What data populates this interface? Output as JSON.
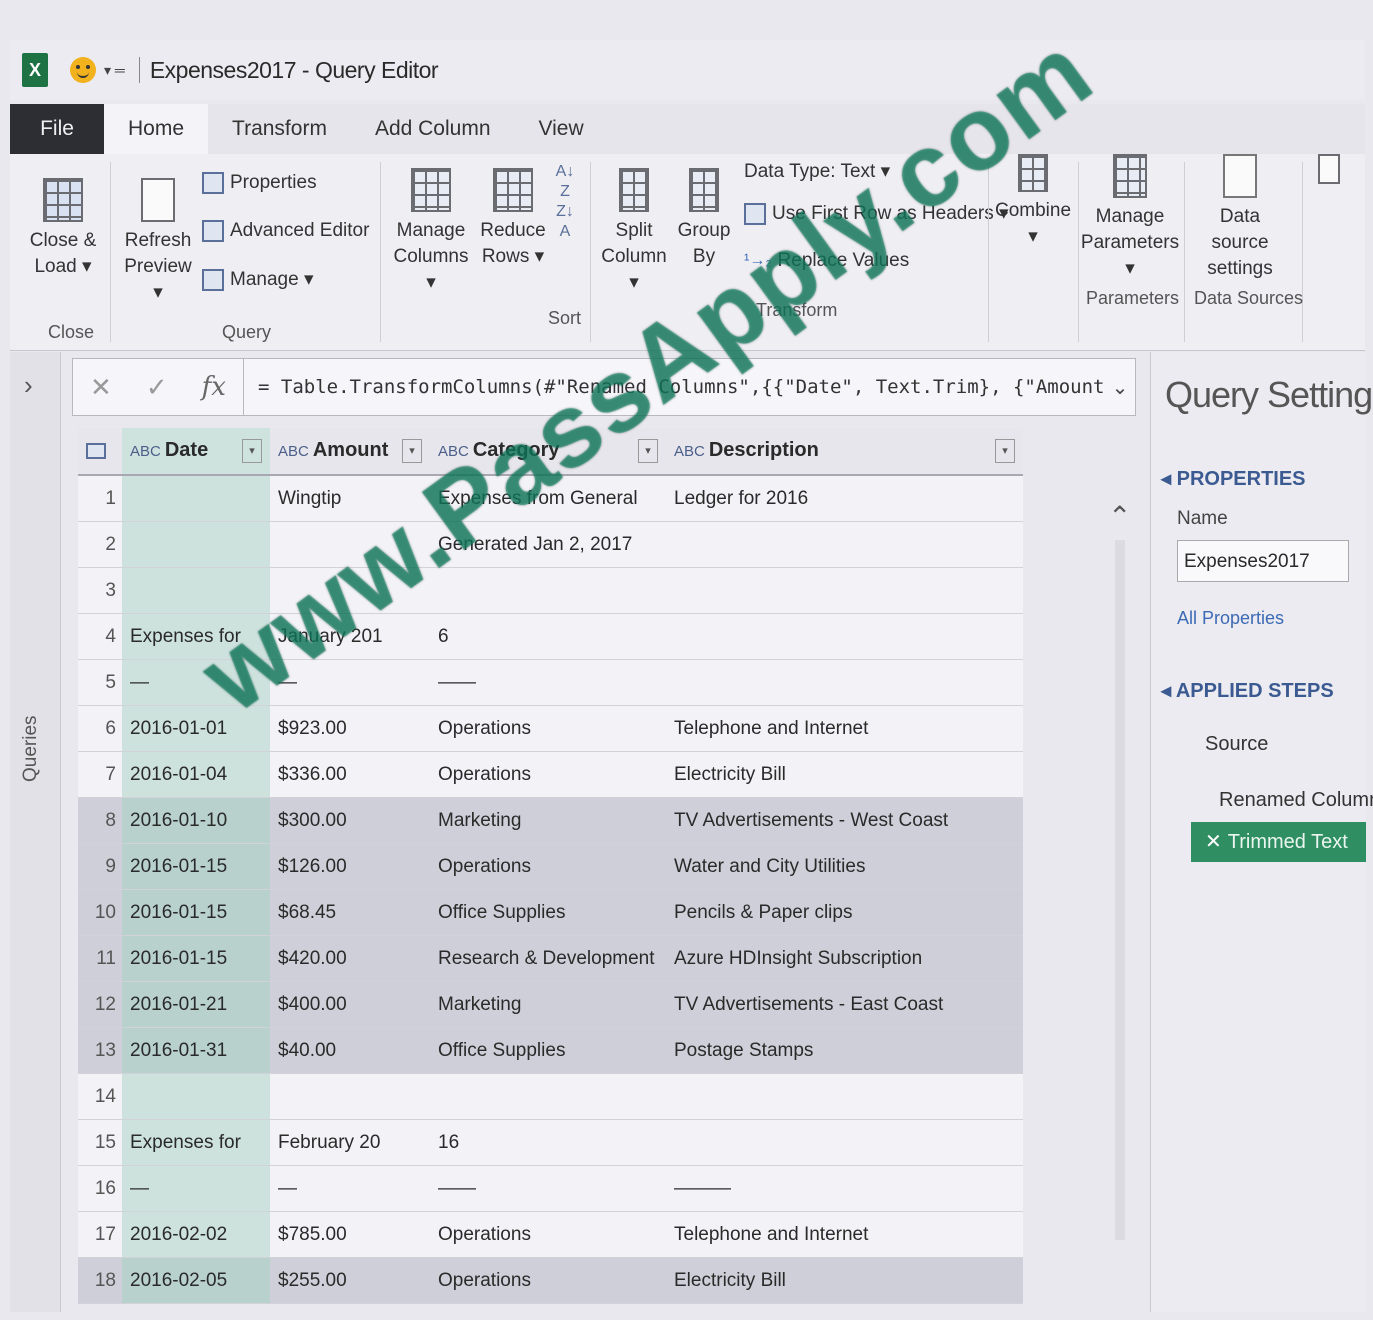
{
  "window": {
    "title": "Expenses2017 - Query Editor",
    "app_icon": "X"
  },
  "tabs": [
    {
      "label": "File"
    },
    {
      "label": "Home"
    },
    {
      "label": "Transform"
    },
    {
      "label": "Add Column"
    },
    {
      "label": "View"
    }
  ],
  "ribbon": {
    "close_load": [
      "Close &",
      "Load"
    ],
    "refresh_preview": [
      "Refresh",
      "Preview"
    ],
    "properties": "Properties",
    "advanced_editor": "Advanced Editor",
    "manage": "Manage",
    "manage_columns": [
      "Manage",
      "Columns"
    ],
    "reduce_rows": [
      "Reduce",
      "Rows"
    ],
    "split_column": [
      "Split",
      "Column"
    ],
    "group_by": [
      "Group",
      "By"
    ],
    "data_type": "Data Type: Text",
    "use_first_row": "Use First Row as Headers",
    "replace_values": "Replace Values",
    "combine": "Combine",
    "manage_parameters": [
      "Manage",
      "Parameters"
    ],
    "data_source_settings": [
      "Data source",
      "settings"
    ],
    "groups": {
      "close": "Close",
      "query": "Query",
      "sort": "Sort",
      "transform": "Transform",
      "parameters": "Parameters",
      "data_sources": "Data Sources"
    }
  },
  "left_rail": {
    "label": "Queries"
  },
  "formula": {
    "text": "= Table.TransformColumns(#\"Renamed Columns\",{{\"Date\", Text.Trim}, {\"Amount"
  },
  "columns": [
    {
      "type": "ABC",
      "name": "Date"
    },
    {
      "type": "ABC",
      "name": "Amount"
    },
    {
      "type": "ABC",
      "name": "Category"
    },
    {
      "type": "ABC",
      "name": "Description"
    }
  ],
  "rows": [
    {
      "n": "1",
      "date": "",
      "amount": "Wingtip",
      "category": "Expenses from General",
      "description": "Ledger for 2016"
    },
    {
      "n": "2",
      "date": "",
      "amount": "",
      "category": "Generated Jan 2, 2017",
      "description": ""
    },
    {
      "n": "3",
      "date": "",
      "amount": "",
      "category": "",
      "description": ""
    },
    {
      "n": "4",
      "date": "Expenses for",
      "amount": "January 201",
      "category": "6",
      "description": ""
    },
    {
      "n": "5",
      "date": "—",
      "amount": "—",
      "category": "——",
      "description": ""
    },
    {
      "n": "6",
      "date": "2016-01-01",
      "amount": "$923.00",
      "category": "Operations",
      "description": "Telephone and Internet"
    },
    {
      "n": "7",
      "date": "2016-01-04",
      "amount": "$336.00",
      "category": "Operations",
      "description": "Electricity Bill"
    },
    {
      "n": "8",
      "date": "2016-01-10",
      "amount": "$300.00",
      "category": "Marketing",
      "description": "TV Advertisements - West Coast"
    },
    {
      "n": "9",
      "date": "2016-01-15",
      "amount": "$126.00",
      "category": "Operations",
      "description": "Water and City Utilities"
    },
    {
      "n": "10",
      "date": "2016-01-15",
      "amount": "$68.45",
      "category": "Office Supplies",
      "description": "Pencils & Paper clips"
    },
    {
      "n": "11",
      "date": "2016-01-15",
      "amount": "$420.00",
      "category": "Research & Development",
      "description": "Azure HDInsight Subscription"
    },
    {
      "n": "12",
      "date": "2016-01-21",
      "amount": "$400.00",
      "category": "Marketing",
      "description": "TV Advertisements - East Coast"
    },
    {
      "n": "13",
      "date": "2016-01-31",
      "amount": "$40.00",
      "category": "Office Supplies",
      "description": "Postage Stamps"
    },
    {
      "n": "14",
      "date": "",
      "amount": "",
      "category": "",
      "description": ""
    },
    {
      "n": "15",
      "date": "Expenses for",
      "amount": "February 20",
      "category": "16",
      "description": ""
    },
    {
      "n": "16",
      "date": "—",
      "amount": "—",
      "category": "——",
      "description": "———"
    },
    {
      "n": "17",
      "date": "2016-02-02",
      "amount": "$785.00",
      "category": "Operations",
      "description": "Telephone and Internet"
    },
    {
      "n": "18",
      "date": "2016-02-05",
      "amount": "$255.00",
      "category": "Operations",
      "description": "Electricity Bill"
    }
  ],
  "query_settings": {
    "title": "Query Settings",
    "properties_heading": "PROPERTIES",
    "name_label": "Name",
    "name_value": "Expenses2017",
    "all_properties": "All Properties",
    "applied_steps_heading": "APPLIED STEPS",
    "steps": [
      "Source",
      "Renamed Columns",
      "Trimmed Text"
    ],
    "active_step": "Trimmed Text"
  },
  "watermark": "www.PassApply.com",
  "colors": {
    "excel_green": "#1f7244",
    "active_step": "#2f8f63",
    "accent_blue": "#3b5a92"
  }
}
